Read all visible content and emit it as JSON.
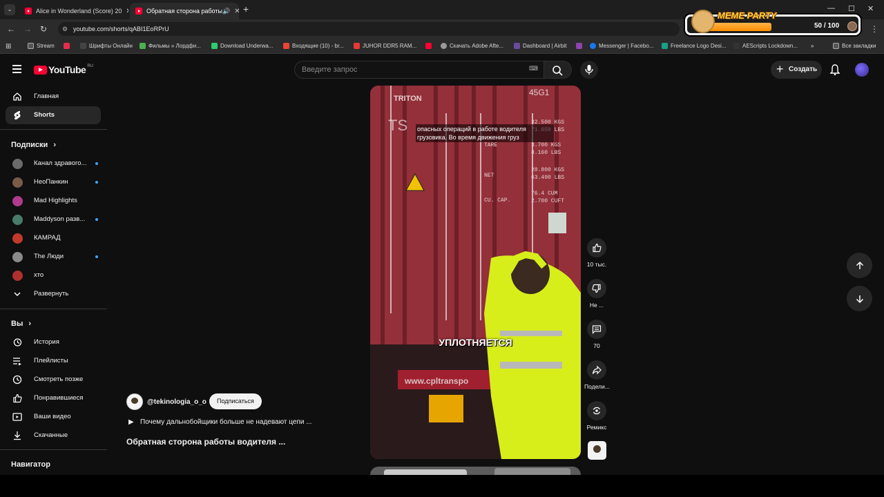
{
  "browser": {
    "tabs": [
      {
        "title": "Alice in Wonderland (Score) 20",
        "active": false
      },
      {
        "title": "Обратная сторона работы",
        "active": true
      }
    ],
    "url": "youtube.com/shorts/qABI1EoRPrU",
    "bookmarks": [
      "Stream",
      "Шрифты Онлайн",
      "Фильмы » Лордфи...",
      "Download Underwa...",
      "Входящие (10) - br...",
      "JUHOR DDR5 RAM...",
      "Скачать Adobe Afte...",
      "Dashboard | Airbit",
      "Messenger | Facebo...",
      "Freelance Logo Desi...",
      "AEScripts Lockdown...",
      "Все закладки"
    ]
  },
  "meme_party": {
    "title": "MEME PARTY",
    "score": "50 / 100",
    "progress": 0.5
  },
  "youtube": {
    "logo": "YouTube",
    "region": "RU",
    "search_placeholder": "Введите запрос",
    "create_label": "Создать",
    "sidebar": {
      "main": [
        {
          "label": "Главная",
          "icon": "home-icon"
        },
        {
          "label": "Shorts",
          "icon": "shorts-icon",
          "active": true
        }
      ],
      "subscriptions_title": "Подписки",
      "subscriptions": [
        {
          "label": "Канал здравого...",
          "color": "#6b6b6b",
          "new": true
        },
        {
          "label": "НеоПанкин",
          "color": "#7a5a48",
          "new": true
        },
        {
          "label": "Mad Highlights",
          "color": "#b03a8c",
          "new": false
        },
        {
          "label": "Maddyson разв...",
          "color": "#4a7a6a",
          "new": true
        },
        {
          "label": "КАМРАД",
          "color": "#c0392b",
          "new": false
        },
        {
          "label": "The Люди",
          "color": "#8a8a8a",
          "new": true
        },
        {
          "label": "хто",
          "color": "#b03030",
          "new": false
        }
      ],
      "expand_label": "Развернуть",
      "you_title": "Вы",
      "you_items": [
        {
          "label": "История",
          "icon": "history-icon"
        },
        {
          "label": "Плейлисты",
          "icon": "playlists-icon"
        },
        {
          "label": "Смотреть позже",
          "icon": "watch-later-icon"
        },
        {
          "label": "Понравившиеся",
          "icon": "liked-icon"
        },
        {
          "label": "Ваши видео",
          "icon": "your-videos-icon"
        },
        {
          "label": "Скачанные",
          "icon": "downloads-icon"
        }
      ],
      "navigator_title": "Навигатор"
    },
    "short": {
      "caption_line1": "опасных операций в работе водителя",
      "caption_line2": "грузовика. Во время движения груз",
      "watermark": "TS",
      "subtitle": "УПЛОТНЯЕТСЯ",
      "channel": "@tekinologia_o_o",
      "subscribe_label": "Подписаться",
      "playlist_title": "Почему дальнобойщики больше не надевают цепи ...",
      "video_title": "Обратная сторона работы водителя ...",
      "actions": {
        "likes": "10 тыс.",
        "dislike": "Не ...",
        "comments": "70",
        "share": "Подели...",
        "remix": "Ремикс"
      }
    }
  }
}
